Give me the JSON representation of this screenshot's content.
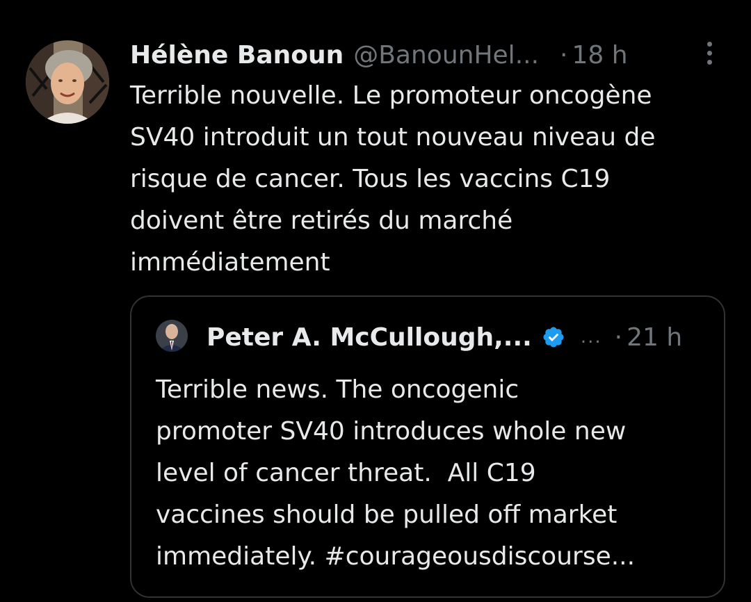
{
  "tweet": {
    "display_name": "Hélène Banoun",
    "handle": "@BanounHel...",
    "separator": "·",
    "time": "18 h",
    "more_icon": "more-vertical-icon",
    "text": "Terrible nouvelle. Le promoteur oncogène\nSV40 introduit un tout nouveau niveau de\nrisque de cancer. Tous les vaccins C19\ndoivent être retirés du marché\nimmédiatement"
  },
  "quoted_tweet": {
    "display_name": "Peter A. McCullough,...",
    "verified_icon": "verified-badge-icon",
    "handle": "...",
    "separator": "·",
    "time": "21 h",
    "text": "Terrible news. The oncogenic\npromoter SV40 introduces whole new\nlevel of cancer threat.  All C19\nvaccines should be pulled off market\nimmediately. #courageousdiscourse..."
  },
  "colors": {
    "background": "#000000",
    "primary_text": "#e7e9ea",
    "secondary_text": "#71767b",
    "border": "#2f3336",
    "verified": "#1d9bf0"
  }
}
